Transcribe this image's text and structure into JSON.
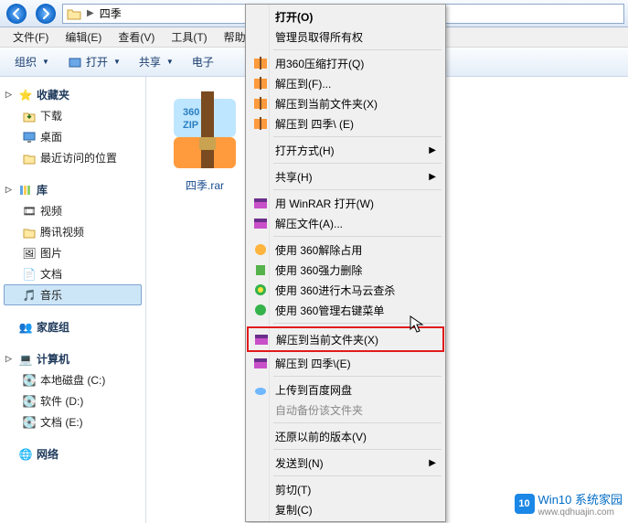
{
  "nav": {
    "path": "四季"
  },
  "menubar": [
    "文件(F)",
    "编辑(E)",
    "查看(V)",
    "工具(T)",
    "帮助(H)"
  ],
  "toolbar": {
    "org": "组织",
    "open": "打开",
    "share": "共享",
    "email": "电子"
  },
  "sidebar": {
    "fav": {
      "title": "收藏夹",
      "items": [
        "下载",
        "桌面",
        "最近访问的位置"
      ]
    },
    "lib": {
      "title": "库",
      "items": [
        "视频",
        "腾讯视频",
        "图片",
        "文档",
        "音乐"
      ]
    },
    "home": {
      "title": "家庭组"
    },
    "pc": {
      "title": "计算机",
      "items": [
        "本地磁盘 (C:)",
        "软件 (D:)",
        "文档 (E:)"
      ]
    },
    "net": {
      "title": "网络"
    }
  },
  "file": {
    "name": "四季.rar",
    "badge": "360",
    "badge2": "ZIP"
  },
  "ctx": {
    "open": "打开(O)",
    "admin": "管理员取得所有权",
    "zip360": "用360压缩打开(Q)",
    "extractTo": "解压到(F)...",
    "extractHere1": "解压到当前文件夹(X)",
    "extractToFolder1": "解压到 四季\\ (E)",
    "openWith": "打开方式(H)",
    "shareH": "共享(H)",
    "winrarOpen": "用 WinRAR 打开(W)",
    "extractFiles": "解压文件(A)...",
    "use360free": "使用 360解除占用",
    "use360force": "使用 360强力删除",
    "use360scan": "使用 360进行木马云查杀",
    "use360menu": "使用 360管理右键菜单",
    "extractHere2": "解压到当前文件夹(X)",
    "extractToFolder2": "解压到 四季\\(E)",
    "uploadBaidu": "上传到百度网盘",
    "autoBackup": "自动备份该文件夹",
    "restore": "还原以前的版本(V)",
    "sendTo": "发送到(N)",
    "cut": "剪切(T)",
    "copy": "复制(C)"
  },
  "watermark": {
    "badge": "10",
    "t1": "Win10 系统家园",
    "t2": "www.qdhuajin.com"
  }
}
